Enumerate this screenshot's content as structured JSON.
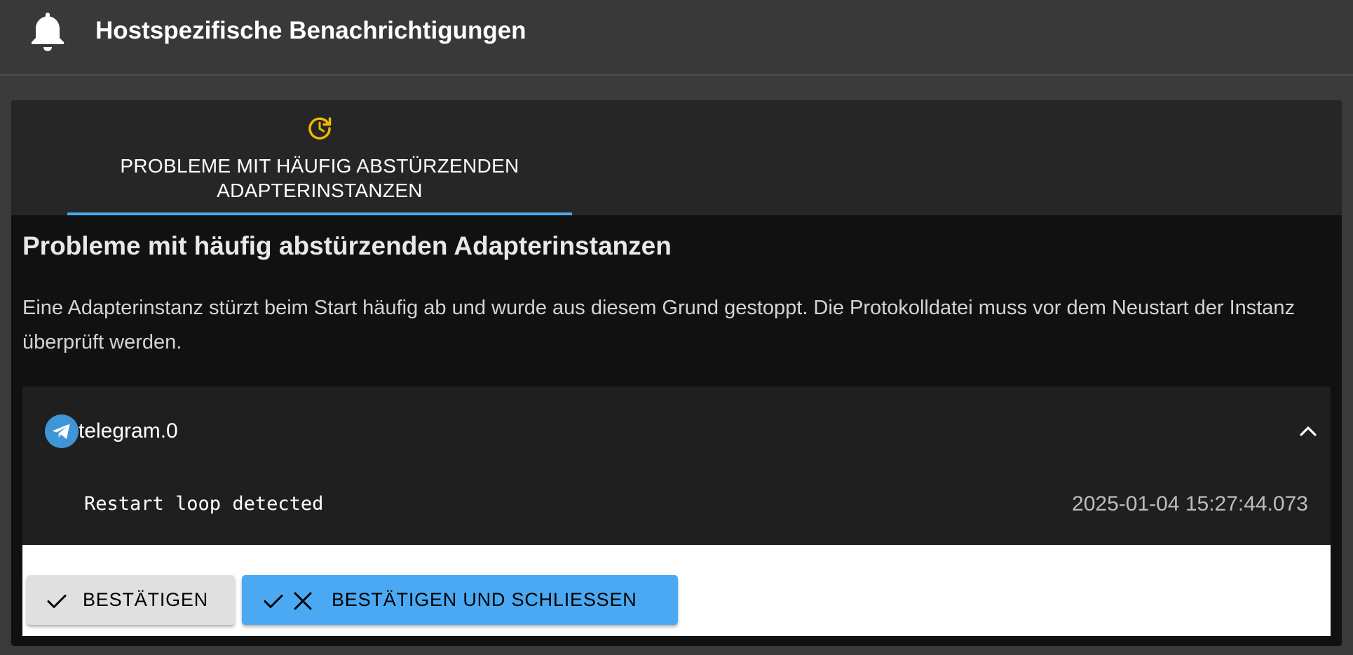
{
  "header": {
    "title": "Hostspezifische Benachrichtigungen",
    "icon": "bell-icon"
  },
  "tabs": [
    {
      "label_line1": "PROBLEME MIT HÄUFIG ABSTÜRZENDEN",
      "label_line2": "ADAPTERINSTANZEN",
      "icon": "restart-clock-icon",
      "icon_color": "#f5b800",
      "active": true
    }
  ],
  "content": {
    "heading": "Probleme mit häufig abstürzenden Adapterinstanzen",
    "description": "Eine Adapterinstanz stürzt beim Start häufig ab und wurde aus diesem Grund gestoppt. Die Protokolldatei muss vor dem Neustart der Instanz überprüft werden."
  },
  "instance": {
    "name": "telegram.0",
    "icon": "telegram-icon",
    "expanded": true,
    "message": "Restart loop detected",
    "timestamp": "2025-01-04 15:27:44.073"
  },
  "actions": {
    "confirm_label": "BESTÄTIGEN",
    "confirm_close_label": "BESTÄTIGEN UND SCHLIESSEN"
  },
  "colors": {
    "accent": "#4aa9f2",
    "warning": "#f5b800",
    "telegram": "#3f95d6"
  }
}
